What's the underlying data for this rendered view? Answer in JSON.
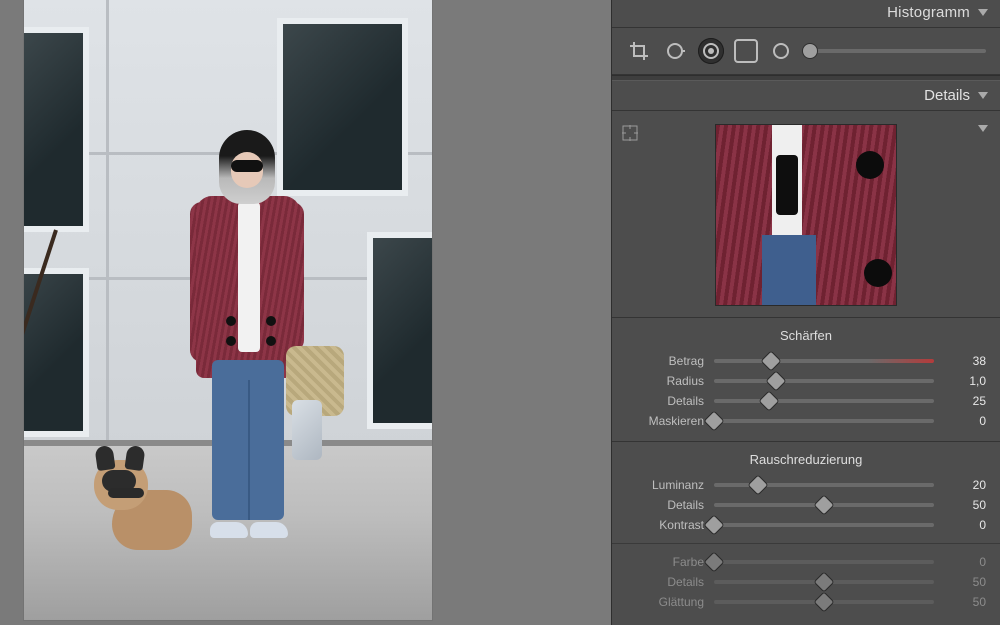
{
  "histogram": {
    "title": "Histogramm"
  },
  "tools": {
    "crop": "crop-tool",
    "spot": "spot-removal-tool",
    "redeye": "redeye-tool",
    "gradient": "graduated-filter-tool",
    "radial": "radial-filter-tool",
    "brush": "adjustment-brush-tool"
  },
  "details": {
    "title": "Details",
    "sharpen": {
      "title": "Schärfen",
      "amount": {
        "label": "Betrag",
        "value": "38",
        "pos": 26
      },
      "radius": {
        "label": "Radius",
        "value": "1,0",
        "pos": 28
      },
      "detail": {
        "label": "Details",
        "value": "25",
        "pos": 25
      },
      "mask": {
        "label": "Maskieren",
        "value": "0",
        "pos": 0
      }
    },
    "noise": {
      "title": "Rauschreduzierung",
      "luminance": {
        "label": "Luminanz",
        "value": "20",
        "pos": 20
      },
      "lum_detail": {
        "label": "Details",
        "value": "50",
        "pos": 50
      },
      "lum_contrast": {
        "label": "Kontrast",
        "value": "0",
        "pos": 0
      },
      "color": {
        "label": "Farbe",
        "value": "0",
        "pos": 0,
        "disabled": true
      },
      "col_detail": {
        "label": "Details",
        "value": "50",
        "pos": 50,
        "disabled": true
      },
      "col_smooth": {
        "label": "Glättung",
        "value": "50",
        "pos": 50,
        "disabled": true
      }
    }
  }
}
